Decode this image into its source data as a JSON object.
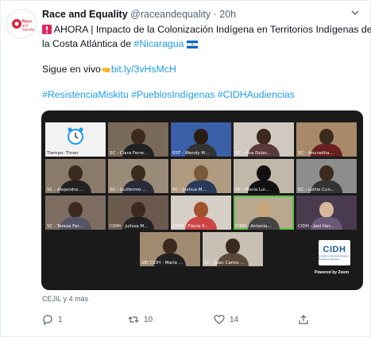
{
  "tweet": {
    "author_name": "Race and Equality",
    "author_handle": "@raceandequality",
    "separator": "·",
    "time": "20h",
    "line1": "AHORA | Impacto de la Colonización Indígena en Territorios Indígenas de",
    "line2_prefix": "la Costa Atlántica de ",
    "line2_link": "#Nicaragua",
    "line3_prefix": "Sigue en vivo",
    "line3_link": "bit.ly/3vHsMcH",
    "hashtags": "#ResistenciaMiskitu #PueblosIndígenas #CIDHAudiencias"
  },
  "media": {
    "tiles": [
      {
        "label": "Tiempo: Timer"
      },
      {
        "label": "SC - Clara Ferre..."
      },
      {
        "label": "EST - Wendy M..."
      },
      {
        "label": "SC - Ana Dolar..."
      },
      {
        "label": "SC - Anuradha..."
      },
      {
        "label": "SC - Alejandra ..."
      },
      {
        "label": "SC - Guillermo ..."
      },
      {
        "label": "SC - Joshua M..."
      },
      {
        "label": "SC - María Lui..."
      },
      {
        "label": "SC - Lottie Cun..."
      },
      {
        "label": "SC - Teresa Fer..."
      },
      {
        "label": "CIDH - Julissa M..."
      },
      {
        "label": "CIDH - Flávia P..."
      },
      {
        "label": "CIDH - Antonia..."
      },
      {
        "label": "CIDH - Joel Her..."
      },
      {
        "label": "SEI CIDH - María ..."
      },
      {
        "label": "SC - Juan Carlos ..."
      }
    ],
    "logo_text": "CIDH",
    "logo_subtext": "Comisión Interamericana de Derechos Humanos",
    "powered_by": "Powered by Zoom"
  },
  "source_line": "CEJIL y 4 más",
  "actions": {
    "reply_count": "1",
    "retweet_count": "10",
    "like_count": "14"
  },
  "colors": {
    "link": "#1d9bf0",
    "muted": "#536471",
    "active_speaker": "#5cc34a"
  }
}
